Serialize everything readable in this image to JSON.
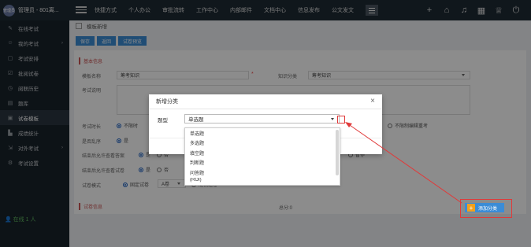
{
  "topbar": {
    "logo_text": "管理员",
    "user": "管理员 - 801离...",
    "nav": [
      "快捷方式",
      "个人办公",
      "审批流转",
      "工作中心",
      "内部邮件",
      "文档中心",
      "信息发布",
      "公文发文"
    ]
  },
  "sidebar": {
    "items": [
      {
        "label": "在线考试",
        "icon": "edit-icon"
      },
      {
        "label": "我的考试",
        "icon": "user-icon",
        "has_arrow": true
      },
      {
        "label": "考试安排",
        "icon": "doc-icon"
      },
      {
        "label": "批阅试卷",
        "icon": "check-icon"
      },
      {
        "label": "阅联历史",
        "icon": "clock-icon"
      },
      {
        "label": "题库",
        "icon": "book-icon"
      },
      {
        "label": "试卷模板",
        "icon": "template-icon",
        "active": true
      },
      {
        "label": "成绩统计",
        "icon": "chart-icon"
      },
      {
        "label": "对外考试",
        "icon": "external-icon",
        "has_arrow": true
      },
      {
        "label": "考试设置",
        "icon": "gear-icon"
      }
    ],
    "online_label": "在线",
    "online_count": "1 人"
  },
  "main": {
    "breadcrumb": "模板新增",
    "toolbar": {
      "save": "保存",
      "back": "返回",
      "preview": "试卷预览"
    },
    "section_basic": "基本信息",
    "template_name_label": "模板名称",
    "template_name_value": "筹考知识",
    "category_label": "知识分类",
    "category_value": "筹考知识",
    "desc_label": "考试说明",
    "duration_label": "考试时长",
    "duration_option": "不限时",
    "no_limit_edit_label": "不限制编辑重考",
    "shuffle_label": "是否乱序",
    "yes": "是",
    "no": "否",
    "show_answer_label": "结束后允许查看答案",
    "show_paper_label": "结束后允许查看试卷",
    "answer_extra": "暂停",
    "paper_mode_label": "试卷模式",
    "paper_mode_fixed": "固定试卷",
    "paper_mode_ab": "A卷",
    "paper_mode_random": "随机组卷",
    "section_questions": "试卷信息",
    "total_score": "总分:0",
    "add_category": "添加分类"
  },
  "modal": {
    "title": "新增分类",
    "type_label": "题型",
    "type_value": "单选题",
    "options": [
      "单选题",
      "多选题",
      "填空题",
      "判断题",
      "问答题",
      "(ROI)"
    ]
  }
}
